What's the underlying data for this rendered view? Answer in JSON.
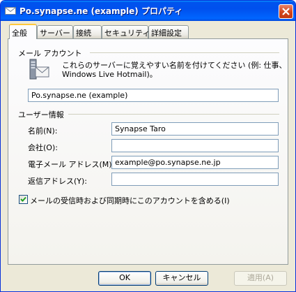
{
  "window": {
    "title": "Po.synapse.ne (example) プロパティ"
  },
  "tabs": [
    "全般",
    "サーバー",
    "接続",
    "セキュリティ",
    "詳細設定"
  ],
  "mail_account": {
    "heading": "メール アカウント",
    "description_line1": "これらのサーバーに覚えやすい名前を付けてください (例: 仕事、",
    "description_line2": "Windows Live Hotmail)。",
    "account_name": "Po.synapse.ne (example)"
  },
  "user_info": {
    "heading": "ユーザー情報",
    "name_label": "名前(N):",
    "name_value": "Synapse Taro",
    "company_label": "会社(O):",
    "company_value": "",
    "email_label": "電子メール アドレス(M):",
    "email_value": "example@po.synapse.ne.jp",
    "reply_label": "返信アドレス(Y):",
    "reply_value": ""
  },
  "include_checkbox": {
    "label": "メールの受信時および同期時にこのアカウントを含める(I)",
    "checked": true
  },
  "buttons": {
    "ok": "OK",
    "cancel": "キャンセル",
    "apply": "適用(A)"
  },
  "icons": {
    "title": "mail-account-icon",
    "close": "close-icon",
    "section": "mail-server-icon",
    "check": "checkmark-icon"
  }
}
